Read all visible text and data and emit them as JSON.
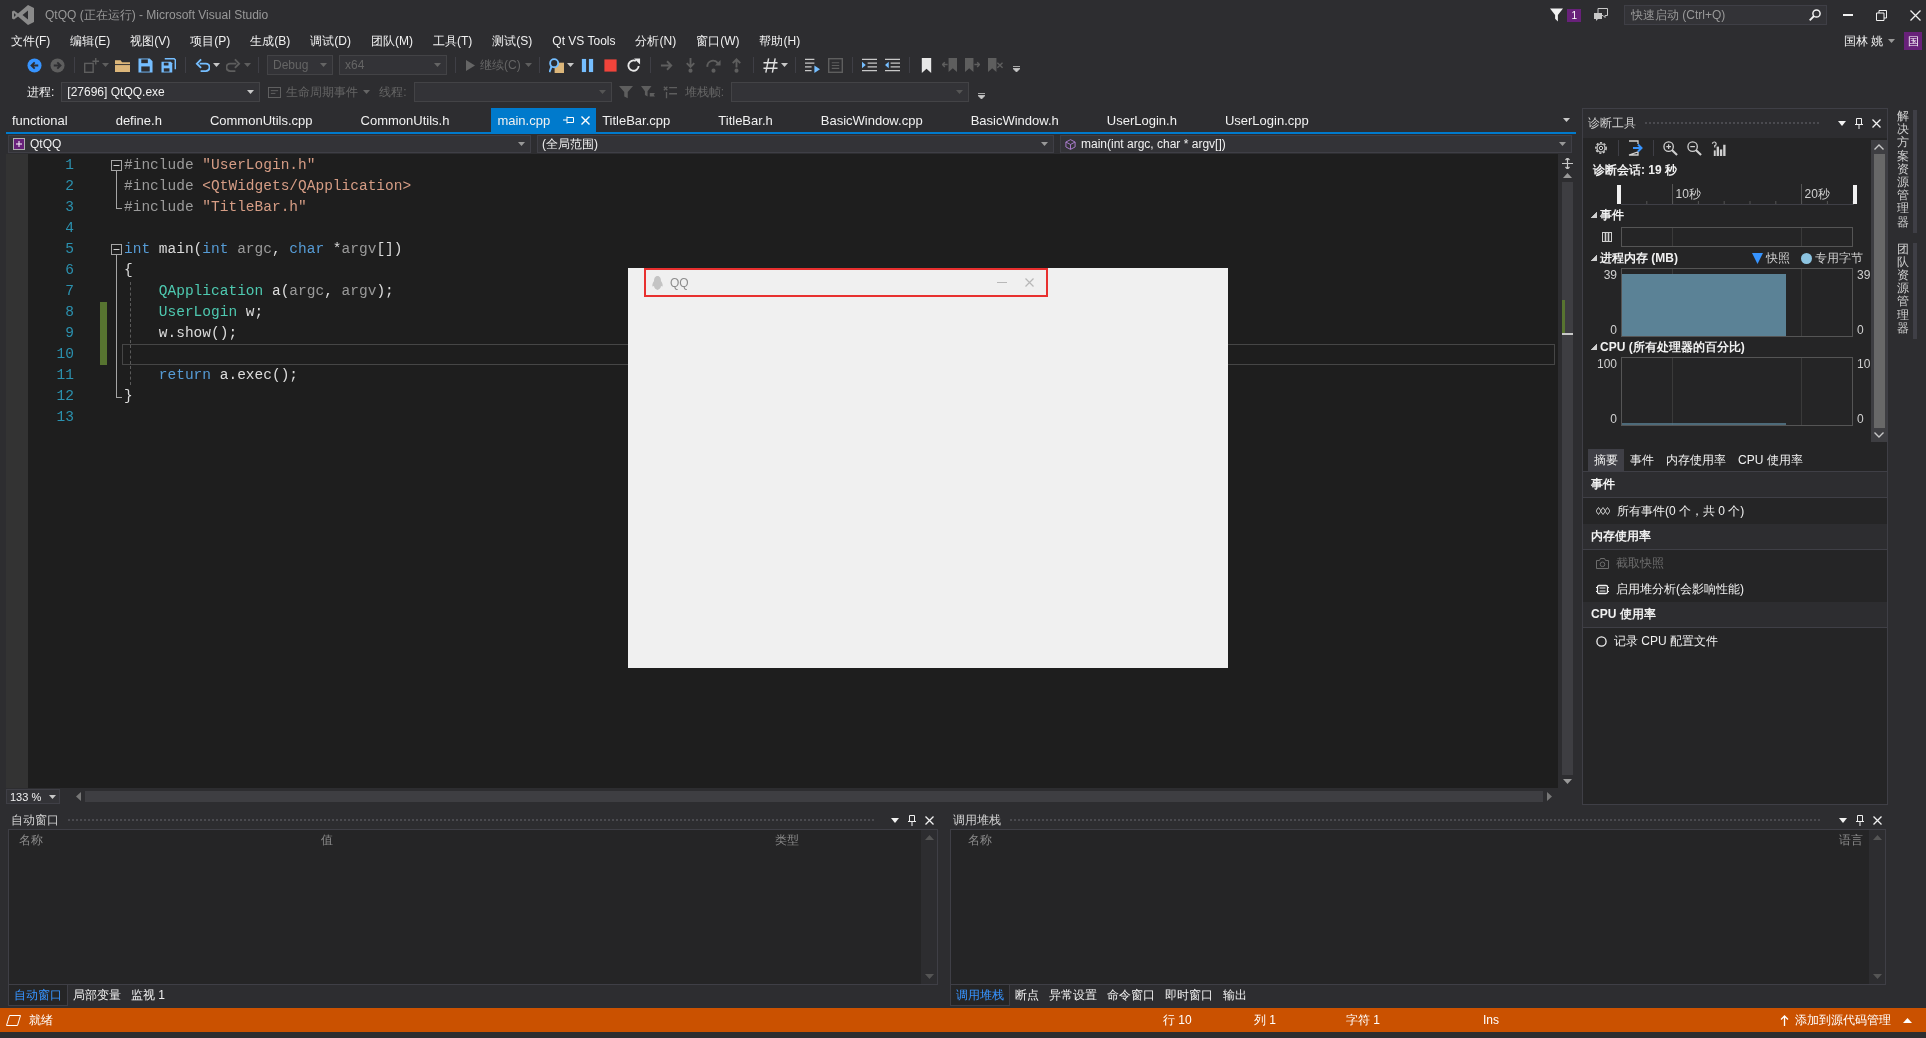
{
  "window": {
    "title": "QtQQ (正在运行) - Microsoft Visual Studio",
    "notifications": "1",
    "quick_launch": {
      "placeholder": "快速启动 (Ctrl+Q)"
    },
    "user": {
      "name": "国林 姚",
      "initial": "国"
    }
  },
  "menu": [
    "文件(F)",
    "编辑(E)",
    "视图(V)",
    "项目(P)",
    "生成(B)",
    "调试(D)",
    "团队(M)",
    "工具(T)",
    "测试(S)",
    "Qt VS Tools",
    "分析(N)",
    "窗口(W)",
    "帮助(H)"
  ],
  "toolbar": [
    [
      {
        "kind": "back",
        "disabled": false
      },
      {
        "kind": "forward",
        "disabled": true
      }
    ],
    [
      {
        "kind": "new",
        "disabled": true
      },
      {
        "kind": "caret",
        "disabled": true
      },
      {
        "kind": "open",
        "disabled": false
      },
      {
        "kind": "save",
        "disabled": false
      },
      {
        "kind": "saveall",
        "disabled": false
      }
    ],
    [
      {
        "kind": "undo",
        "disabled": false
      },
      {
        "kind": "caret",
        "disabled": false
      },
      {
        "kind": "redo",
        "disabled": true
      },
      {
        "kind": "caret",
        "disabled": true
      }
    ],
    [
      {
        "kind": "combo",
        "text": "Debug",
        "disabled": true
      },
      {
        "kind": "combo",
        "text": "x64",
        "disabled": true
      }
    ],
    [
      {
        "kind": "run",
        "text": "继续(C)",
        "disabled": true
      },
      {
        "kind": "caret",
        "disabled": true
      }
    ],
    [
      {
        "kind": "process",
        "disabled": false
      },
      {
        "kind": "caret",
        "disabled": false
      },
      {
        "kind": "pause",
        "disabled": false
      },
      {
        "kind": "stop",
        "disabled": false
      },
      {
        "kind": "restart",
        "disabled": false
      }
    ],
    [
      {
        "kind": "shownext",
        "disabled": true
      },
      {
        "kind": "stepinto",
        "disabled": true
      },
      {
        "kind": "stepover",
        "disabled": true
      },
      {
        "kind": "stepout",
        "disabled": true
      }
    ],
    [
      {
        "kind": "hex",
        "disabled": false
      },
      {
        "kind": "caret",
        "disabled": false
      }
    ],
    [
      {
        "kind": "threads",
        "disabled": false
      },
      {
        "kind": "window",
        "disabled": true
      }
    ],
    [
      {
        "kind": "indent",
        "disabled": false
      },
      {
        "kind": "outdent",
        "disabled": false
      }
    ],
    [
      {
        "kind": "bookmark",
        "disabled": false
      },
      {
        "kind": "bmprev",
        "disabled": true
      },
      {
        "kind": "bmnext",
        "disabled": true
      },
      {
        "kind": "bmclear",
        "disabled": true
      }
    ]
  ],
  "debug_location": [
    {
      "kind": "label",
      "text": "进程:",
      "disabled": false
    },
    {
      "kind": "combo",
      "text": "[27696] QtQQ.exe",
      "disabled": false
    },
    {
      "kind": "lifecycle",
      "text": "生命周期事件",
      "disabled": true
    },
    {
      "kind": "label",
      "text": "线程:",
      "disabled": true
    },
    {
      "kind": "combo",
      "disabled": true
    },
    {
      "kind": "filter",
      "disabled": true
    },
    {
      "kind": "flagfilter",
      "disabled": true
    },
    {
      "kind": "flags",
      "disabled": true
    },
    {
      "kind": "label",
      "text": "堆栈帧:",
      "disabled": true
    },
    {
      "kind": "combo",
      "disabled": true
    }
  ],
  "documents": [
    {
      "label": "functional",
      "selected": false
    },
    {
      "label": "define.h",
      "selected": false
    },
    {
      "label": "CommonUtils.cpp",
      "selected": false
    },
    {
      "label": "CommonUtils.h",
      "selected": false
    },
    {
      "label": "main.cpp",
      "selected": true
    },
    {
      "label": "TitleBar.cpp",
      "selected": false
    },
    {
      "label": "TitleBar.h",
      "selected": false
    },
    {
      "label": "BasicWindow.cpp",
      "selected": false
    },
    {
      "label": "BasicWindow.h",
      "selected": false
    },
    {
      "label": "UserLogin.h",
      "selected": false
    },
    {
      "label": "UserLogin.cpp",
      "selected": false
    }
  ],
  "navigation": {
    "project": "QtQQ",
    "scope": "(全局范围)",
    "member": "main(int argc, char * argv[])"
  },
  "editor": {
    "lines": [
      {
        "number": "1",
        "kind": "start",
        "changed": false,
        "current": false,
        "tokens": [
          {
            "kind": "pre",
            "text": "#include"
          },
          {
            "kind": "str",
            "text": " \"UserLogin.h\""
          }
        ]
      },
      {
        "number": "2",
        "kind": "inner",
        "changed": false,
        "current": false,
        "tokens": [
          {
            "kind": "pre",
            "text": "#include"
          },
          {
            "kind": "str",
            "text": " <QtWidgets/QApplication>"
          }
        ]
      },
      {
        "number": "3",
        "kind": "end",
        "changed": false,
        "current": false,
        "tokens": [
          {
            "kind": "pre",
            "text": "#include"
          },
          {
            "kind": "str",
            "text": " \"TitleBar.h\""
          }
        ]
      },
      {
        "number": "4",
        "kind": "blank",
        "changed": false,
        "current": false
      },
      {
        "number": "5",
        "kind": "start",
        "changed": false,
        "current": false,
        "tokens": [
          {
            "kind": "kw",
            "text": "int"
          },
          {
            "kind": "plain",
            "text": " main("
          },
          {
            "kind": "kw",
            "text": "int"
          },
          {
            "kind": "param",
            "text": " argc"
          },
          {
            "kind": "plain",
            "text": ", "
          },
          {
            "kind": "kw",
            "text": "char"
          },
          {
            "kind": "plain",
            "text": " *"
          },
          {
            "kind": "param",
            "text": "argv"
          },
          {
            "kind": "plain",
            "text": "[])"
          }
        ]
      },
      {
        "number": "6",
        "kind": "inner",
        "changed": false,
        "current": false,
        "tokens": [
          {
            "kind": "plain",
            "text": "{"
          }
        ]
      },
      {
        "number": "7",
        "kind": "body",
        "changed": false,
        "current": false,
        "tokens": [
          {
            "kind": "type",
            "text": "    QApplication"
          },
          {
            "kind": "plain",
            "text": " a("
          },
          {
            "kind": "param",
            "text": "argc"
          },
          {
            "kind": "plain",
            "text": ", "
          },
          {
            "kind": "param",
            "text": "argv"
          },
          {
            "kind": "plain",
            "text": ");"
          }
        ]
      },
      {
        "number": "8",
        "kind": "body",
        "changed": true,
        "current": false,
        "tokens": [
          {
            "kind": "type",
            "text": "    UserLogin"
          },
          {
            "kind": "plain",
            "text": " w;"
          }
        ]
      },
      {
        "number": "9",
        "kind": "body",
        "changed": true,
        "current": false,
        "tokens": [
          {
            "kind": "plain",
            "text": "    w.show();"
          }
        ]
      },
      {
        "number": "10",
        "kind": "body",
        "changed": true,
        "current": true
      },
      {
        "number": "11",
        "kind": "body",
        "changed": false,
        "current": false,
        "tokens": [
          {
            "kind": "kw",
            "text": "    return"
          },
          {
            "kind": "plain",
            "text": " a.exec();"
          }
        ]
      },
      {
        "number": "12",
        "kind": "end",
        "changed": false,
        "current": false,
        "tokens": [
          {
            "kind": "plain",
            "text": "}"
          }
        ]
      },
      {
        "number": "13",
        "kind": "blank",
        "changed": false,
        "current": false
      }
    ],
    "zoom": "133 %"
  },
  "qq_window": {
    "title": "QQ",
    "highlighted": true
  },
  "diagnostics": {
    "title": "诊断工具",
    "session": "诊断会话: 19 秒",
    "timeline": {
      "ticks": [
        "10秒",
        "20秒"
      ]
    },
    "events": {
      "title": "事件",
      "expanded": true
    },
    "charts": [
      {
        "title": "进程内存 (MB)",
        "kind": "area",
        "expanded": true,
        "legend": [
          {
            "kind": "triangle",
            "label": "快照",
            "color": "#3794ff"
          },
          {
            "kind": "circle",
            "label": "专用字节",
            "color": "#8cc3e0"
          }
        ],
        "left_ticks": [
          "39",
          "0"
        ],
        "right_ticks": [
          "39",
          "0"
        ]
      },
      {
        "title": "CPU (所有处理器的百分比)",
        "kind": "line",
        "expanded": true,
        "left_ticks": [
          "100",
          "0"
        ],
        "right_ticks": [
          "10",
          "0"
        ]
      }
    ],
    "tabs": [
      {
        "label": "摘要",
        "selected": true
      },
      {
        "label": "事件",
        "selected": false
      },
      {
        "label": "内存使用率",
        "selected": false
      },
      {
        "label": "CPU 使用率",
        "selected": false
      }
    ],
    "sections": [
      {
        "title": "事件",
        "items": [
          {
            "kind": "events",
            "label": "所有事件(0 个，共 0 个)",
            "disabled": false
          }
        ]
      },
      {
        "title": "内存使用率",
        "items": [
          {
            "kind": "snapshot",
            "label": "截取快照",
            "disabled": true
          },
          {
            "kind": "heap",
            "label": "启用堆分析(会影响性能)",
            "disabled": false
          }
        ]
      },
      {
        "title": "CPU 使用率",
        "items": [
          {
            "kind": "record",
            "label": "记录 CPU 配置文件",
            "disabled": false
          }
        ]
      }
    ]
  },
  "autos": {
    "title": "自动窗口",
    "columns": [
      "名称",
      "值",
      "类型"
    ],
    "tabs": [
      {
        "label": "自动窗口",
        "selected": true
      },
      {
        "label": "局部变量",
        "selected": false
      },
      {
        "label": "监视 1",
        "selected": false
      }
    ]
  },
  "call_stack": {
    "title": "调用堆栈",
    "columns": [
      "名称",
      "语言"
    ],
    "tabs": [
      {
        "label": "调用堆栈",
        "selected": true
      },
      {
        "label": "断点",
        "selected": false
      },
      {
        "label": "异常设置",
        "selected": false
      },
      {
        "label": "命令窗口",
        "selected": false
      },
      {
        "label": "即时窗口",
        "selected": false
      },
      {
        "label": "输出",
        "selected": false
      }
    ]
  },
  "side_tabs": [
    "解决方案资源管理器",
    "团队资源管理器"
  ],
  "status_bar": {
    "ready": "就绪",
    "line": "行 10",
    "column": "列 1",
    "char": "字符 1",
    "mode": "Ins",
    "source_control": "添加到源代码管理"
  }
}
